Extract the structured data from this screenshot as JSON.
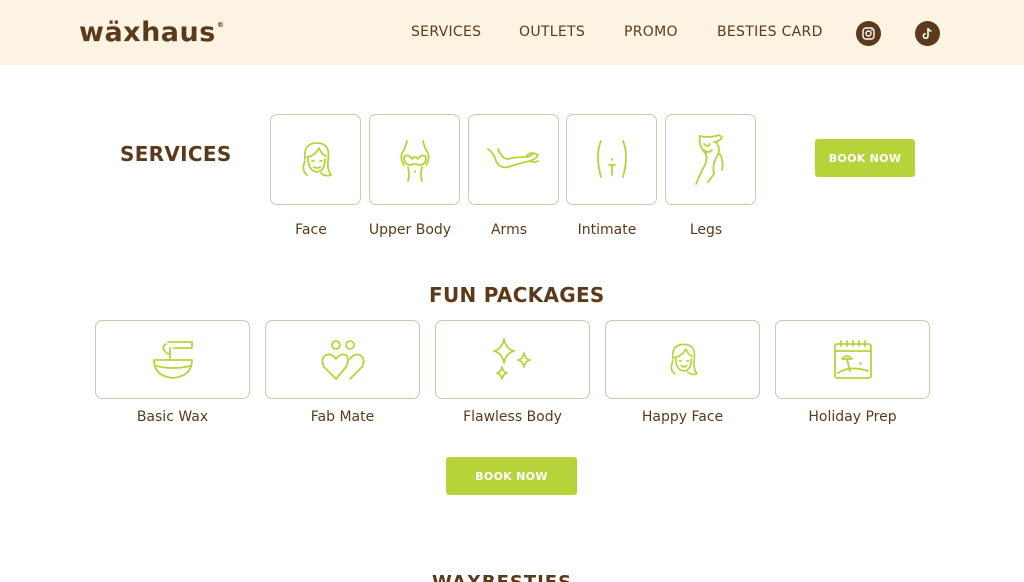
{
  "brand": {
    "logo_text": "wäxhaus",
    "registered": "®"
  },
  "nav": {
    "items": [
      "SERVICES",
      "OUTLETS",
      "PROMO",
      "BESTIES CARD"
    ],
    "social": [
      "instagram-icon",
      "tiktok-icon"
    ]
  },
  "services": {
    "title": "SERVICES",
    "items": [
      {
        "label": "Face",
        "icon": "face-icon"
      },
      {
        "label": "Upper Body",
        "icon": "upper-body-icon"
      },
      {
        "label": "Arms",
        "icon": "arms-icon"
      },
      {
        "label": "Intimate",
        "icon": "intimate-icon"
      },
      {
        "label": "Legs",
        "icon": "legs-icon"
      }
    ],
    "book_label": "BOOK NOW"
  },
  "packages": {
    "title": "FUN PACKAGES",
    "items": [
      {
        "label": "Basic Wax",
        "icon": "wax-bowl-icon"
      },
      {
        "label": "Fab Mate",
        "icon": "hearts-icon"
      },
      {
        "label": "Flawless Body",
        "icon": "sparkles-icon"
      },
      {
        "label": "Happy Face",
        "icon": "face-icon"
      },
      {
        "label": "Holiday Prep",
        "icon": "calendar-beach-icon"
      }
    ],
    "book_label": "BOOK NOW"
  },
  "next_section": {
    "title_partial": "WAXBESTIES"
  },
  "colors": {
    "brand_brown": "#5b3a1c",
    "accent_green": "#b6d43a",
    "header_bg": "#fdf3e3",
    "tile_border": "#d8c4ae"
  }
}
